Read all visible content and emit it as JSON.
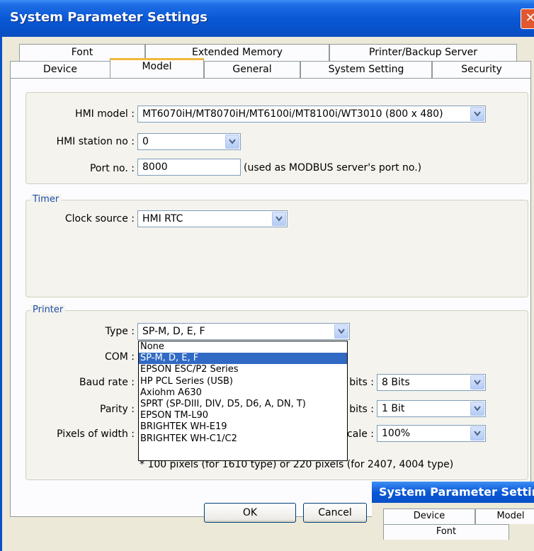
{
  "window": {
    "title": "System Parameter Settings",
    "close_label": "✕"
  },
  "tabs_row1": [
    "Font",
    "Extended Memory",
    "Printer/Backup Server"
  ],
  "tabs_row2": [
    "Device",
    "Model",
    "General",
    "System Setting",
    "Security"
  ],
  "selected_tab": "Model",
  "model": {
    "hmi_model_label": "HMI model :",
    "hmi_model_value": "MT6070iH/MT8070iH/MT6100i/MT8100i/WT3010 (800 x 480)",
    "station_label": "HMI station no :",
    "station_value": "0",
    "port_label": "Port no. :",
    "port_value": "8000",
    "port_note": "(used as MODBUS server's port no.)"
  },
  "timer": {
    "legend": "Timer",
    "clock_label": "Clock source :",
    "clock_value": "HMI RTC"
  },
  "printer": {
    "legend": "Printer",
    "type_label": "Type :",
    "type_value": "SP-M, D, E, F",
    "com_label": "COM :",
    "baud_label": "Baud rate :",
    "parity_label": "Parity :",
    "pixels_label": "Pixels of width :",
    "data_bits_label": "bits :",
    "data_bits_value": "8 Bits",
    "stop_bits_label": "bits :",
    "stop_bits_value": "1 Bit",
    "scale_label": "cale :",
    "scale_value": "100%",
    "note": "* 100 pixels (for 1610 type) or 220 pixels (for 2407, 4004 type)"
  },
  "type_dropdown": {
    "options": [
      "None",
      "SP-M, D, E, F",
      "EPSON ESC/P2 Series",
      "HP PCL Series (USB)",
      "Axiohm A630",
      "SPRT (SP-DIII, DIV, D5, D6, A, DN, T)",
      "EPSON TM-L90",
      "BRIGHTEK WH-E19",
      "BRIGHTEK WH-C1/C2"
    ],
    "selected_index": 1
  },
  "buttons": {
    "ok": "OK",
    "cancel": "Cancel"
  },
  "overlay_window": {
    "title": "System Parameter Settings",
    "tab_device": "Device",
    "tab_model": "Model",
    "tab_font": "Font"
  }
}
